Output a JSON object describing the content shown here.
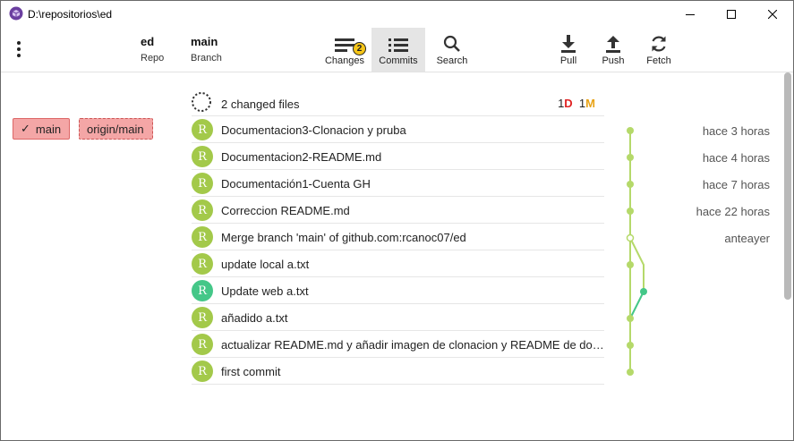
{
  "window": {
    "title": "D:\\repositorios\\ed"
  },
  "toolbar": {
    "repo": {
      "value": "ed",
      "label": "Repo"
    },
    "branch": {
      "value": "main",
      "label": "Branch"
    },
    "changes": {
      "label": "Changes",
      "badge": "2"
    },
    "commits": {
      "label": "Commits"
    },
    "search": {
      "label": "Search"
    },
    "pull": {
      "label": "Pull"
    },
    "push": {
      "label": "Push"
    },
    "fetch": {
      "label": "Fetch"
    }
  },
  "branches": {
    "local": {
      "label": "main",
      "check": "✓"
    },
    "remote": {
      "label": "origin/main"
    }
  },
  "changes_summary": {
    "text": "2 changed files",
    "deleted_count": "1",
    "deleted_letter": "D",
    "modified_count": "1",
    "modified_letter": "M"
  },
  "commits": [
    {
      "avatar": "R",
      "message": "Documentacion3-Clonacion y pruba",
      "time": "hace 3 horas"
    },
    {
      "avatar": "R",
      "message": "Documentacion2-README.md",
      "time": "hace 4 horas"
    },
    {
      "avatar": "R",
      "message": "Documentación1-Cuenta GH",
      "time": "hace 7 horas"
    },
    {
      "avatar": "R",
      "message": "Correccion README.md",
      "time": "hace 22 horas"
    },
    {
      "avatar": "R",
      "message": "Merge branch 'main' of github.com:rcanoc07/ed",
      "time": "anteayer"
    },
    {
      "avatar": "R",
      "message": "update local a.txt",
      "time": ""
    },
    {
      "avatar": "R",
      "message": "Update web a.txt",
      "time": ""
    },
    {
      "avatar": "R",
      "message": "añadido a.txt",
      "time": ""
    },
    {
      "avatar": "R",
      "message": "actualizar README.md y añadir imagen de clonacion y README de docu...",
      "time": ""
    },
    {
      "avatar": "R",
      "message": "first commit",
      "time": ""
    }
  ],
  "colors": {
    "avatar_main": "#a3c94a",
    "avatar_alt": "#44c788",
    "graph_main": "#b5d96a",
    "graph_alt": "#44c788",
    "branch_chip": "#f4a6a6"
  }
}
